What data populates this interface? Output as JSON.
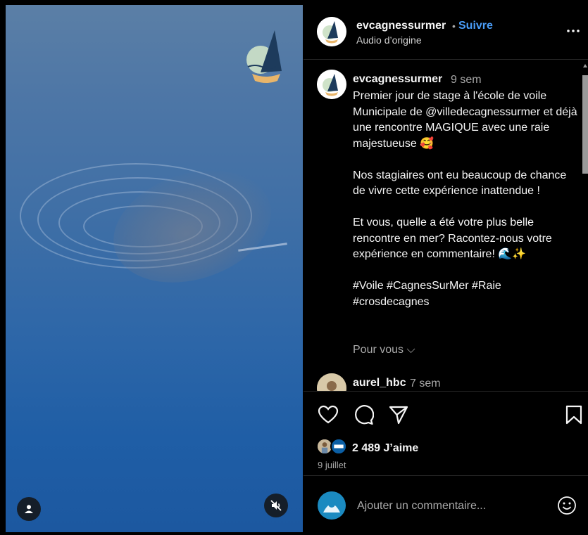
{
  "header": {
    "username": "evcagnessurmer",
    "separator": "•",
    "follow_label": "Suivre",
    "audio_label": "Audio d’origine"
  },
  "post": {
    "username": "evcagnessurmer",
    "time": "9 sem",
    "caption": "Premier jour de stage à l'école de voile Municipale de @villedecagnessurmer et déjà une rencontre MAGIQUE avec une raie majestueuse 🥰\n\nNos stagiaires ont eu beaucoup de chance de vivre cette expérience inattendue !\n\nEt vous, quelle a été votre plus belle rencontre en mer? Racontez-nous votre expérience en commentaire! 🌊✨\n\n#Voile #CagnesSurMer #Raie #crosdecagnes",
    "see_more": "Pour vous ⌵"
  },
  "comments": [
    {
      "username": "aurel_hbc",
      "time": "7 sem"
    }
  ],
  "stats": {
    "likes": "2 489 J’aime",
    "date": "9 juillet"
  },
  "comment_box": {
    "placeholder": "Ajouter un commentaire..."
  },
  "icons": {
    "like": "heart-icon",
    "comment": "comment-icon",
    "share": "share-icon",
    "save": "bookmark-icon",
    "more": "more-icon",
    "emoji": "emoji-icon",
    "mute": "muted-icon",
    "tagged": "user-icon"
  },
  "colors": {
    "follow": "#4a9df8",
    "background": "#000000",
    "muted_text": "#a8a8a8"
  }
}
